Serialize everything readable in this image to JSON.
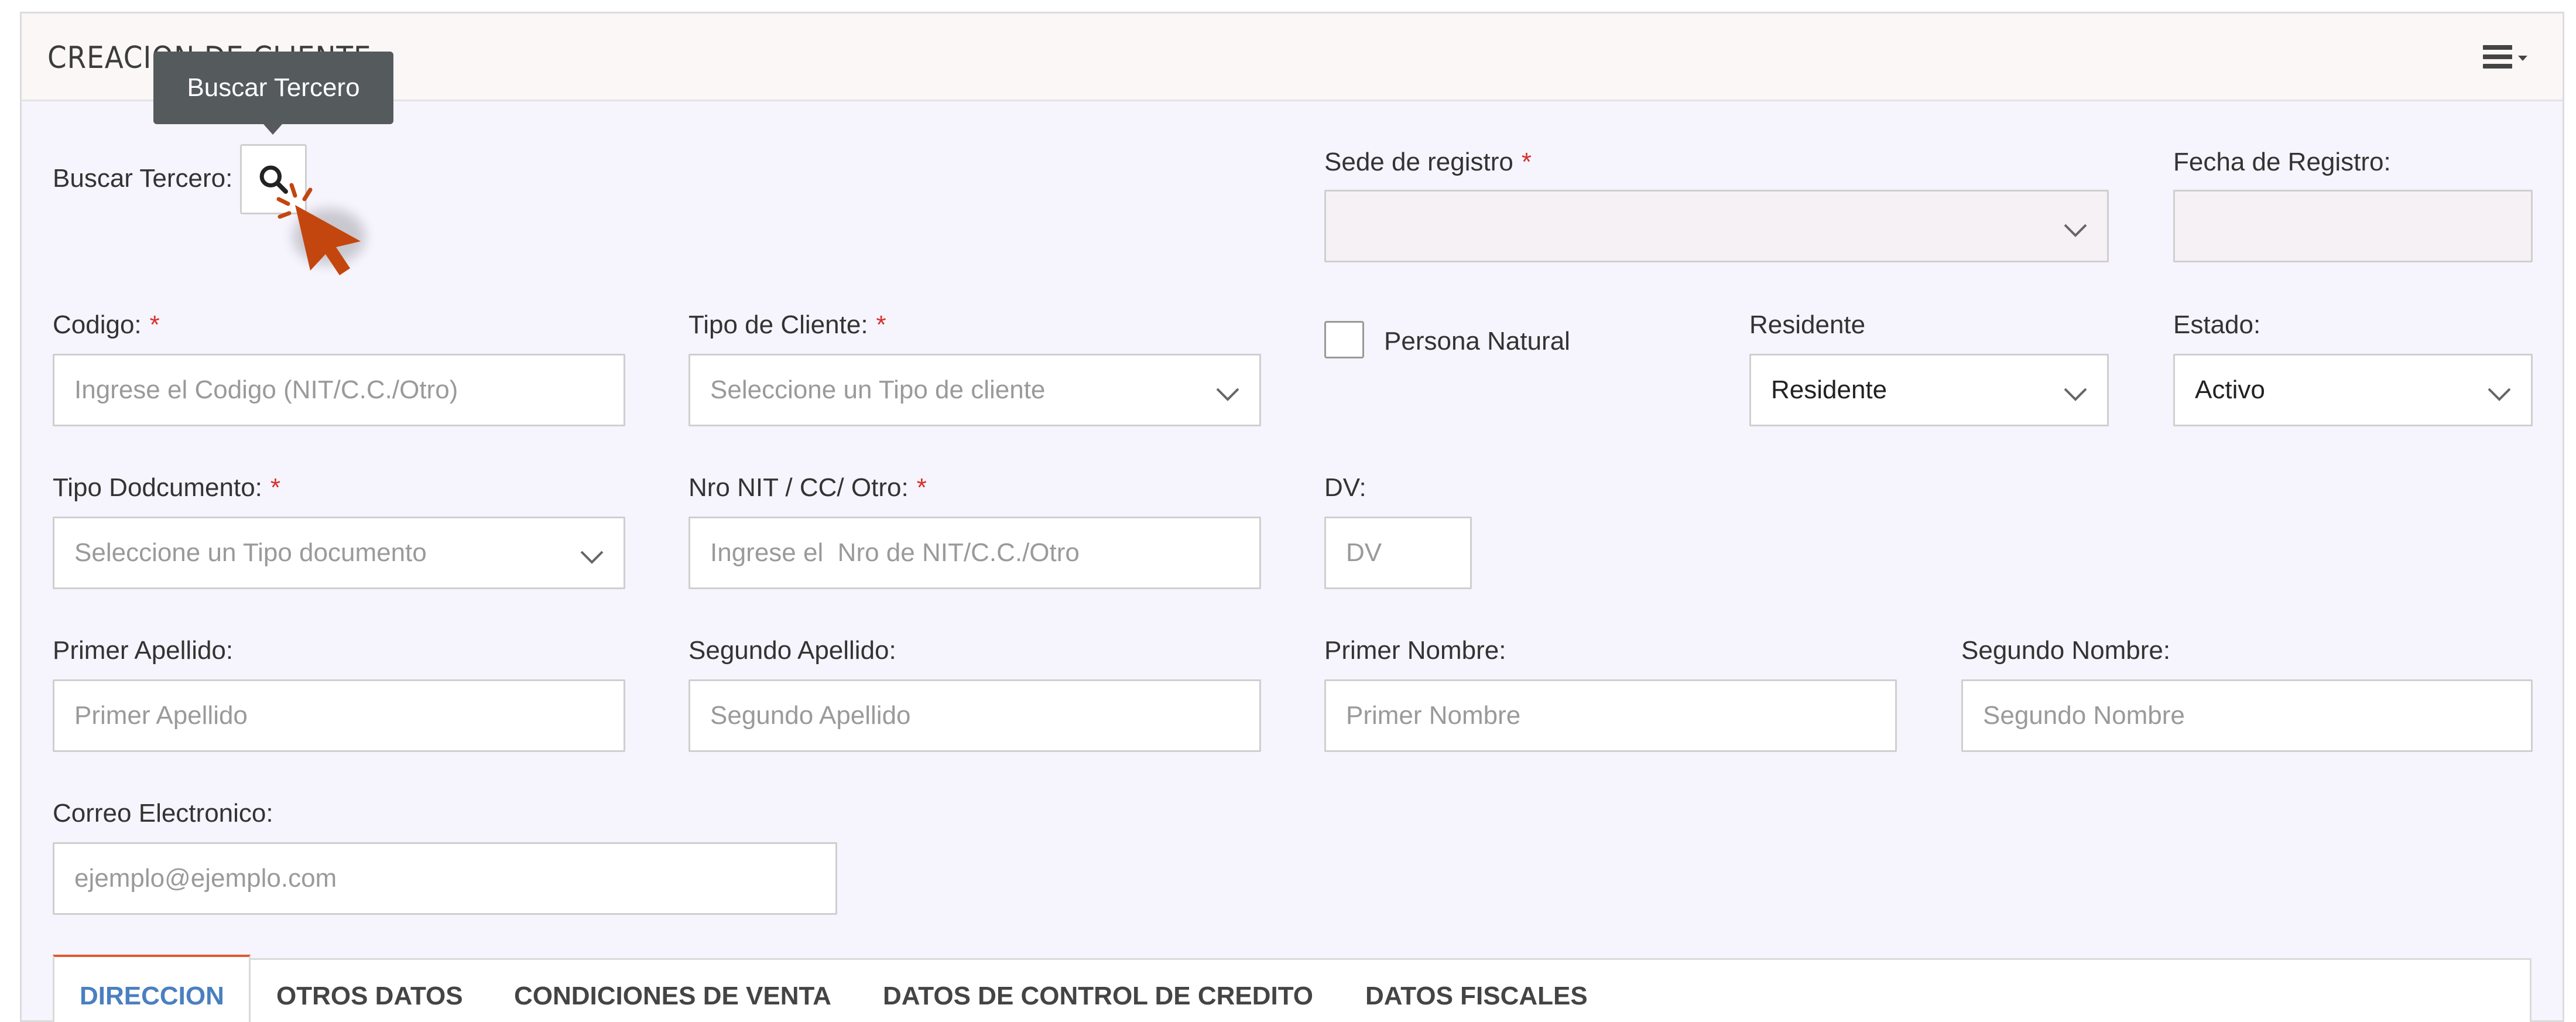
{
  "panel": {
    "title": "CREACION DE CLIENTE",
    "menu_icon": "hamburger-menu-icon"
  },
  "tooltip": "Buscar Tercero",
  "buscar": {
    "label": "Buscar Tercero:",
    "icon": "search-icon"
  },
  "sede": {
    "label": "Sede de registro",
    "required": "*",
    "value": ""
  },
  "fecha": {
    "label": "Fecha de Registro:",
    "value": ""
  },
  "codigo": {
    "label": "Codigo:",
    "required": "*",
    "placeholder": "Ingrese el Codigo (NIT/C.C./Otro)"
  },
  "tipo_cliente": {
    "label": "Tipo de Cliente:",
    "required": "*",
    "placeholder": "Seleccione un Tipo de cliente"
  },
  "persona_natural": {
    "label": "Persona Natural",
    "checked": false
  },
  "residente": {
    "label": "Residente",
    "value": "Residente"
  },
  "estado": {
    "label": "Estado:",
    "value": "Activo"
  },
  "tipo_documento": {
    "label": "Tipo Dodcumento:",
    "required": "*",
    "placeholder": "Seleccione un Tipo documento"
  },
  "nro_nit": {
    "label": "Nro NIT / CC/ Otro:",
    "required": "*",
    "placeholder": "Ingrese el  Nro de NIT/C.C./Otro"
  },
  "dv": {
    "label": "DV:",
    "placeholder": "DV"
  },
  "primer_apellido": {
    "label": "Primer Apellido:",
    "placeholder": "Primer Apellido"
  },
  "segundo_apellido": {
    "label": "Segundo Apellido:",
    "placeholder": "Segundo Apellido"
  },
  "primer_nombre": {
    "label": "Primer Nombre:",
    "placeholder": "Primer Nombre"
  },
  "segundo_nombre": {
    "label": "Segundo Nombre:",
    "placeholder": "Segundo Nombre"
  },
  "correo": {
    "label": "Correo Electronico:",
    "placeholder": "ejemplo@ejemplo.com"
  },
  "tabs": [
    {
      "label": "DIRECCION",
      "active": true
    },
    {
      "label": "OTROS DATOS",
      "active": false
    },
    {
      "label": "CONDICIONES DE VENTA",
      "active": false
    },
    {
      "label": "DATOS DE CONTROL DE CREDITO",
      "active": false
    },
    {
      "label": "DATOS FISCALES",
      "active": false
    }
  ],
  "colors": {
    "accent": "#4a7fc0",
    "required": "#d9302c",
    "tab_border": "#e0582f",
    "cursor": "#c4460f",
    "tooltip_bg": "#555a5d"
  }
}
